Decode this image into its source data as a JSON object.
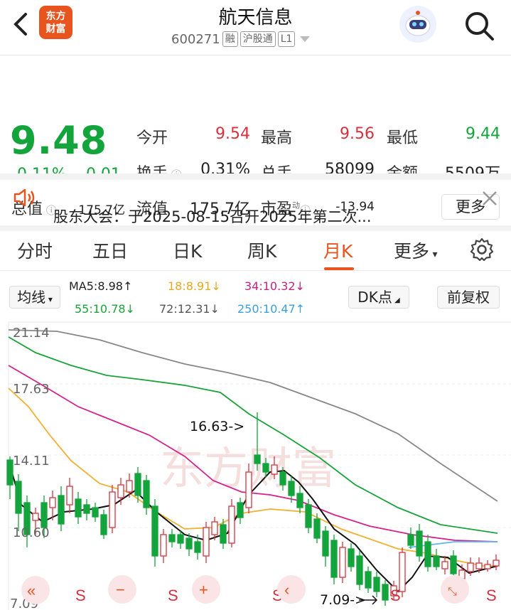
{
  "header": {
    "title": "航天信息",
    "code": "600271",
    "tags": [
      "融",
      "沪股通",
      "L1"
    ],
    "logo_line1": "东方",
    "logo_line2": "财富"
  },
  "quote": {
    "price": "9.48",
    "change_pct": "-0.11%",
    "change": "-0.01",
    "open_label": "今开",
    "open": "9.54",
    "high_label": "最高",
    "high": "9.56",
    "low_label": "最低",
    "low": "9.44",
    "turnover_label": "换手",
    "turnover": "0.31%",
    "volume_label": "总手",
    "volume": "58099",
    "amount_label": "金额",
    "amount": "5509万",
    "mcap_label": "总值",
    "mcap": "175.7亿",
    "float_label": "流值",
    "float_cap": "175.7亿",
    "pe_label": "市盈",
    "pe_sup": "动",
    "pe": "-13.94",
    "more_label": "更多"
  },
  "notice": {
    "text": "股东大会：于2025-08-15召开2025年第二次..."
  },
  "tabs": [
    {
      "label": "分时"
    },
    {
      "label": "五日"
    },
    {
      "label": "日K"
    },
    {
      "label": "周K"
    },
    {
      "label": "月K",
      "active": true
    },
    {
      "label": "更多"
    }
  ],
  "ma_bar": {
    "indicator": "均线",
    "ma5": "MA5:8.98↑",
    "ma18": "18:8.91↓",
    "ma34": "34:10.32↓",
    "ma55": "55:10.78↓",
    "ma72": "72:12.31↓",
    "ma250": "250:10.47↑",
    "dk": "DK点",
    "fq": "前复权"
  },
  "chart": {
    "y_labels": [
      "21.14",
      "17.63",
      "14.11",
      "10.60",
      "7.09"
    ],
    "annot_high": "16.63->",
    "annot_low": "7.09->",
    "watermark": "东方财富",
    "colors": {
      "up": "#d6323e",
      "down": "#13a53c",
      "ma5": "#111111",
      "ma18": "#f0b030",
      "ma34": "#d4238c",
      "ma55": "#1aa33a",
      "ma72": "#888888",
      "ma250": "#5bb8f0"
    }
  }
}
